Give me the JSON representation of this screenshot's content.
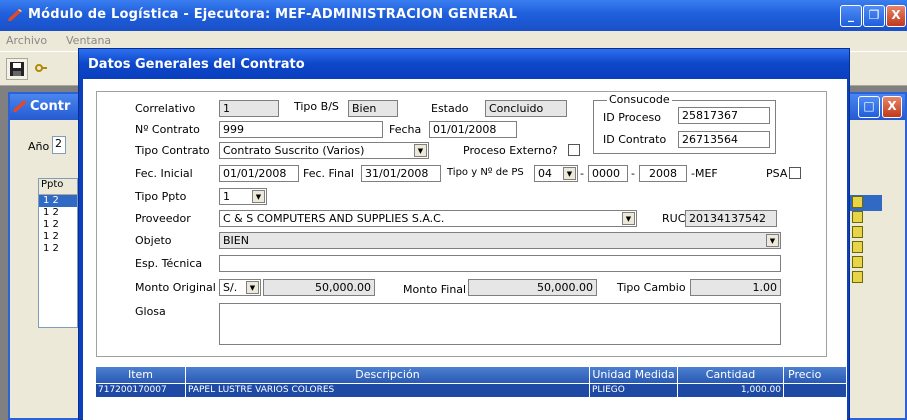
{
  "window": {
    "title": "Módulo de Logística - Ejecutora: MEF-ADMINISTRACION GENERAL",
    "minimize": "_",
    "restore": "❐",
    "close": "X"
  },
  "menu": {
    "items": [
      "Archivo",
      "Ventana"
    ]
  },
  "toolbar": {
    "save_icon": "floppy-disk-icon"
  },
  "child_window": {
    "title": "Contr",
    "year_label": "Año",
    "year_value": "2",
    "table_header": "Ppto",
    "rows": [
      "1  2",
      "1  2",
      "1  2",
      "1  2",
      "1  2"
    ]
  },
  "dialog": {
    "title": "Datos Generales del Contrato",
    "fields": {
      "correlativo_label": "Correlativo",
      "correlativo_value": "1",
      "tipo_bs_label": "Tipo B/S",
      "tipo_bs_value": "Bien",
      "estado_label": "Estado",
      "estado_value": "Concluido",
      "consucode_label": "Consucode",
      "id_proceso_label": "ID Proceso",
      "id_proceso_value": "25817367",
      "id_contrato_label": "ID Contrato",
      "id_contrato_value": "26713564",
      "nro_contrato_label": "Nº Contrato",
      "nro_contrato_value": "999",
      "fecha_label": "Fecha",
      "fecha_value": "01/01/2008",
      "tipo_contrato_label": "Tipo Contrato",
      "tipo_contrato_value": "Contrato Suscrito (Varios)",
      "proceso_externo_label": "Proceso Externo?",
      "fec_inicial_label": "Fec. Inicial",
      "fec_inicial_value": "01/01/2008",
      "fec_final_label": "Fec. Final",
      "fec_final_value": "31/01/2008",
      "tipo_ps_label": "Tipo y Nº de PS",
      "tipo_ps_value": "04",
      "ps_num_value": "0000",
      "ps_year_value": "2008",
      "ps_suffix": "-MEF",
      "psa_label": "PSA",
      "tipo_ppto_label": "Tipo Ppto",
      "tipo_ppto_value": "1",
      "proveedor_label": "Proveedor",
      "proveedor_value": "C & S COMPUTERS AND SUPPLIES S.A.C.",
      "ruc_label": "RUC",
      "ruc_value": "20134137542",
      "objeto_label": "Objeto",
      "objeto_value": "BIEN",
      "esp_tecnica_label": "Esp. Técnica",
      "esp_tecnica_value": "",
      "monto_original_label": "Monto Original",
      "moneda_value": "S/.",
      "monto_original_value": "50,000.00",
      "monto_final_label": "Monto Final",
      "monto_final_value": "50,000.00",
      "tipo_cambio_label": "Tipo Cambio",
      "tipo_cambio_value": "1.00",
      "glosa_label": "Glosa",
      "glosa_value": ""
    },
    "items_table": {
      "columns": [
        "Item",
        "Descripción",
        "Unidad Medida",
        "Cantidad",
        "Precio"
      ],
      "rows": [
        {
          "item": "717200170007",
          "descripcion": "PAPEL LUSTRE VARIOS COLORES",
          "unidad": "PLIEGO",
          "cantidad": "1,000.00",
          "precio": ""
        }
      ]
    }
  }
}
